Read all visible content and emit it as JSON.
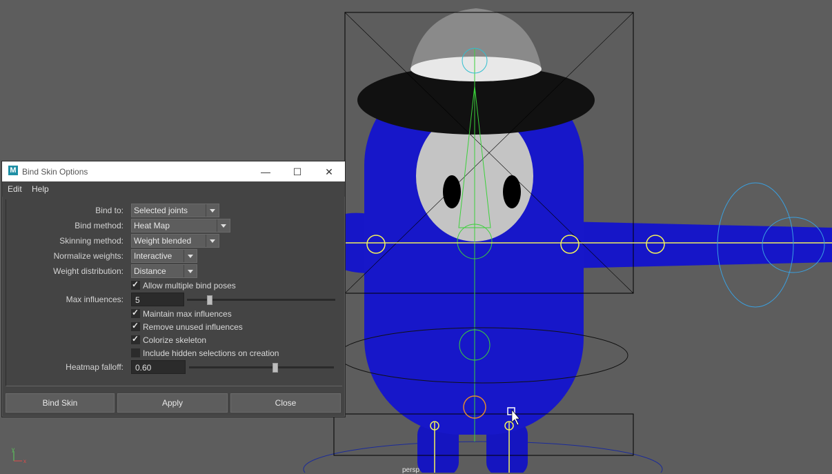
{
  "dialog": {
    "title": "Bind Skin Options",
    "menu": [
      "Edit",
      "Help"
    ],
    "bind_to": {
      "label": "Bind to:",
      "value": "Selected joints"
    },
    "bind_method": {
      "label": "Bind method:",
      "value": "Heat Map"
    },
    "skinning_method": {
      "label": "Skinning method:",
      "value": "Weight blended"
    },
    "normalize_weights": {
      "label": "Normalize weights:",
      "value": "Interactive"
    },
    "weight_distribution": {
      "label": "Weight distribution:",
      "value": "Distance"
    },
    "allow_multiple_bind_poses": {
      "label": "Allow multiple bind poses",
      "checked": true
    },
    "max_influences": {
      "label": "Max influences:",
      "value": "5"
    },
    "maintain_max_influences": {
      "label": "Maintain max influences",
      "checked": true
    },
    "remove_unused_influences": {
      "label": "Remove unused influences",
      "checked": true
    },
    "colorize_skeleton": {
      "label": "Colorize skeleton",
      "checked": true
    },
    "include_hidden": {
      "label": "Include hidden selections on creation",
      "checked": false
    },
    "heatmap_falloff": {
      "label": "Heatmap falloff:",
      "value": "0.60"
    },
    "buttons": {
      "bind_skin": "Bind Skin",
      "apply": "Apply",
      "close": "Close"
    }
  },
  "viewport": {
    "camera_label": "persp",
    "axis_y": "y",
    "axis_x": "x"
  }
}
